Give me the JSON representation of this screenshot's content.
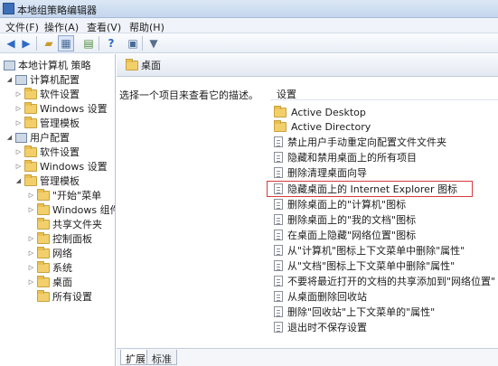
{
  "window": {
    "title": "本地组策略编辑器"
  },
  "menu": [
    "文件(F)",
    "操作(A)",
    "查看(V)",
    "帮助(H)"
  ],
  "toolbar": {
    "icons": [
      "back-arrow-icon",
      "forward-arrow-icon",
      "up-folder-icon",
      "show-hide-tree-icon",
      "export-list-icon",
      "help-icon",
      "properties-icon",
      "filter-icon"
    ]
  },
  "tree": {
    "root": "本地计算机 策略",
    "computer_config": "计算机配置",
    "computer_children": [
      "软件设置",
      "Windows 设置",
      "管理模板"
    ],
    "user_config": "用户配置",
    "user_children": [
      "软件设置",
      "Windows 设置",
      "管理模板"
    ],
    "admin_children": [
      "\"开始\"菜单",
      "Windows 组件",
      "共享文件夹",
      "控制面板",
      "网络",
      "系统",
      "桌面",
      "所有设置"
    ]
  },
  "right": {
    "header": "桌面",
    "description": "选择一个项目来查看它的描述。",
    "column": "设置",
    "folders": [
      "Active Desktop",
      "Active Directory"
    ],
    "settings": [
      "禁止用户手动重定向配置文件文件夹",
      "隐藏和禁用桌面上的所有项目",
      "删除清理桌面向导",
      "隐藏桌面上的 Internet Explorer 图标",
      "删除桌面上的\"计算机\"图标",
      "删除桌面上的\"我的文档\"图标",
      "在桌面上隐藏\"网络位置\"图标",
      "从\"计算机\"图标上下文菜单中删除\"属性\"",
      "从\"文档\"图标上下文菜单中删除\"属性\"",
      "不要将最近打开的文档的共享添加到\"网络位置\"",
      "从桌面删除回收站",
      "删除\"回收站\"上下文菜单的\"属性\"",
      "退出时不保存设置"
    ],
    "tabs": [
      "扩展",
      "标准"
    ]
  },
  "colors": {
    "highlight_border": "#d63a3a"
  }
}
